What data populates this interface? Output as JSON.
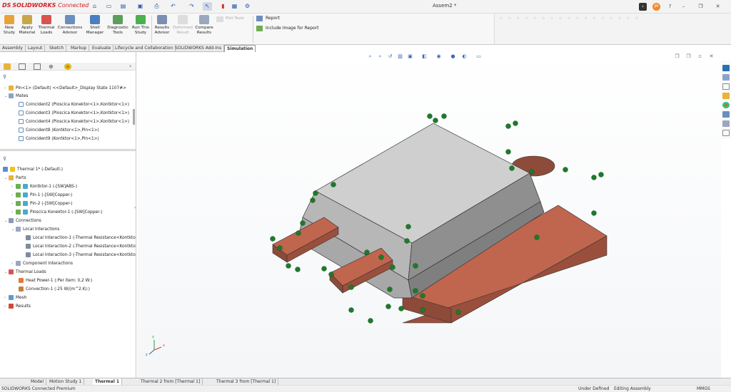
{
  "app": {
    "logo_ds": "DS",
    "logo_name": "SOLIDWORKS",
    "logo_suffix": "Connected",
    "doc_title": "Assem2 *"
  },
  "command_manager": {
    "buttons": [
      {
        "id": "new-study",
        "label": "New\nStudy"
      },
      {
        "id": "apply-material",
        "label": "Apply\nMaterial"
      },
      {
        "id": "thermal-loads",
        "label": "Thermal\nLoads"
      },
      {
        "id": "connections-advisor",
        "label": "Connections\nAdvisor"
      },
      {
        "id": "shell-manager",
        "label": "Shell\nManager"
      },
      {
        "id": "diagnostic-tools",
        "label": "Diagnostic\nTools"
      },
      {
        "id": "run-this-study",
        "label": "Run This\nStudy"
      },
      {
        "id": "results-advisor",
        "label": "Results\nAdvisor"
      },
      {
        "id": "deformed-result",
        "label": "Deformed\nResult"
      },
      {
        "id": "compare-results",
        "label": "Compare\nResults"
      }
    ],
    "plot_tools": "Plot Tools",
    "report": "Report",
    "include_image": "Include Image for Report"
  },
  "tabs": [
    "Assembly",
    "Layout",
    "Sketch",
    "Markup",
    "Evaluate",
    "Lifecycle and Collaboration",
    "SOLIDWORKS Add-Ins",
    "Simulation"
  ],
  "active_tab": "Simulation",
  "feature_tree": {
    "pin": "Pin<1> (Default) <<Default>_Display State 1107#>",
    "mates": "Mates",
    "mate_items": [
      "Coincident2 (Ploscica Konektor<1>,Kontktor<1>)",
      "Coincident3 (Ploscica Konektor<1>,Kontktor<1>)",
      "Coincident4 (Ploscica Konektor<1>,Kontktor<1>)",
      "Coincident8 (Kontktor<1>,Pin<1>)",
      "Coincident9 (Kontktor<1>,Pin<1>)"
    ]
  },
  "study_tree": {
    "root": "Thermal 1* (-Default-)",
    "parts": "Parts",
    "part_items": [
      "Kontktor-1 (-[SW]ABS-)",
      "Pin-1 (-[SW]Copper-)",
      "Pin-2 (-[SW]Copper-)",
      "Ploscica Konektor-1 (-[SW]Copper-)"
    ],
    "connections": "Connections",
    "local_interactions": "Local Interactions",
    "interaction_items": [
      "Local Interaction-1 (-Thermal Resistance<Kontkto",
      "Local Interaction-2 (-Thermal Resistance<Kontkto",
      "Local Interaction-3 (-Thermal Resistance<Kontkto"
    ],
    "component_interactions": "Component Interactions",
    "thermal_loads": "Thermal Loads",
    "load_items": [
      "Heat Power-1 (:Per item: 0,2 W:)",
      "Convection-1 (:25 W/(m^2.K):)"
    ],
    "mesh": "Mesh",
    "results": "Results"
  },
  "axes": {
    "x": "x",
    "y": "Y",
    "z": "z"
  },
  "bottom_tabs": [
    "Model",
    "Motion Study 1",
    "Thermal 1",
    "Thermal 2 from [Thermal 1]",
    "Thermal 3 from [Thermal 1]"
  ],
  "status": {
    "left": "SOLIDWORKS Connected Premium",
    "under_defined": "Under Defined",
    "editing": "Editing Assembly",
    "units": "MMGS"
  },
  "user_initials": "JM",
  "colors": {
    "accent": "#d41f26",
    "copper": "#b85a45",
    "plastic": "#c4c4c4",
    "arrow": "#1e7a2a"
  }
}
